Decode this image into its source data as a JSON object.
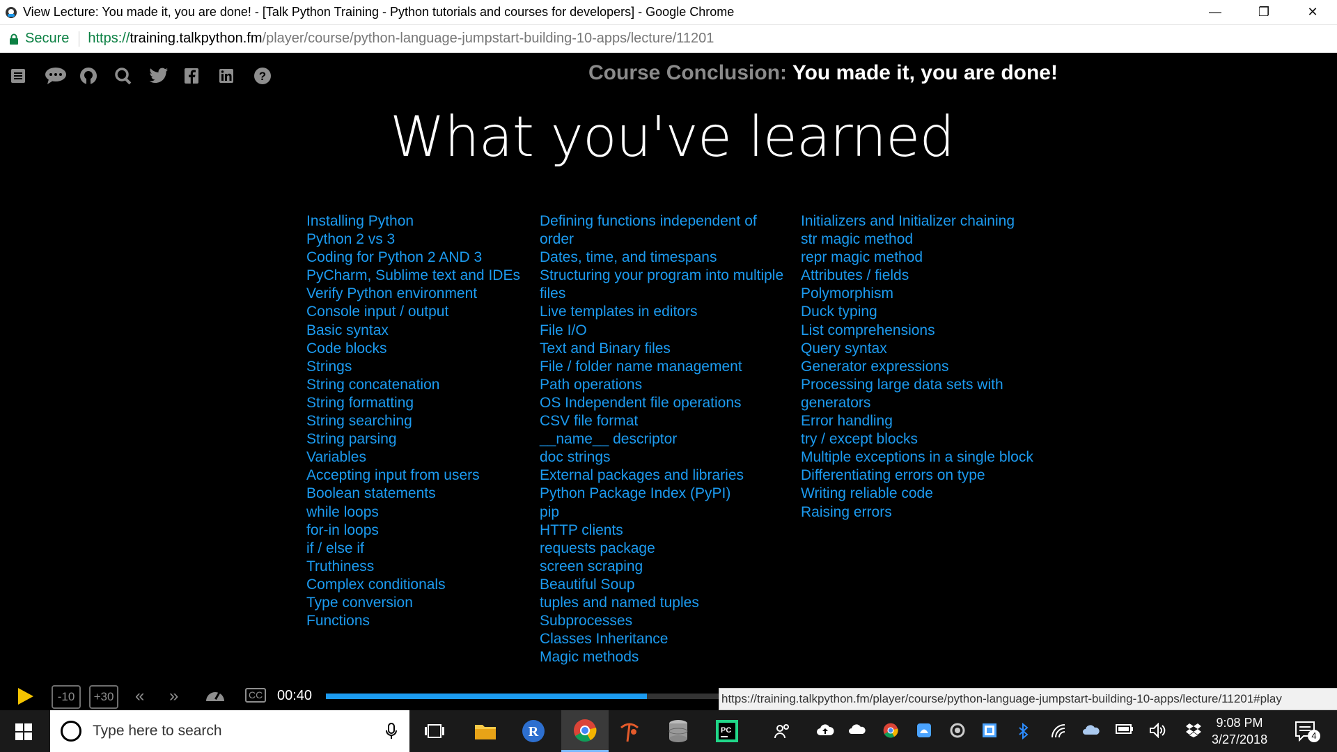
{
  "window": {
    "title": "View Lecture: You made it, you are done! - [Talk Python Training - Python tutorials and courses for developers] - Google Chrome",
    "minimize": "—",
    "restore": "❐",
    "close": "✕"
  },
  "address": {
    "secure_label": "Secure",
    "url_proto": "https://",
    "url_host": "training.talkpython.fm",
    "url_path": "/player/course/python-language-jumpstart-building-10-apps/lecture/11201"
  },
  "header": {
    "section_label": "Course Conclusion:",
    "lecture_title": "You made it, you are done!"
  },
  "slide": {
    "title": "What you've learned",
    "col1": [
      "Installing Python",
      "Python 2 vs 3",
      "Coding for Python 2 AND 3",
      "PyCharm, Sublime text and IDEs",
      "Verify Python environment",
      "Console input / output",
      "Basic syntax",
      "Code blocks",
      "Strings",
      "String concatenation",
      "String formatting",
      "String searching",
      "String parsing",
      "Variables",
      "Accepting input from users",
      "Boolean statements",
      "while loops",
      "for-in loops",
      "if / else if",
      "Truthiness",
      "Complex conditionals",
      "Type conversion",
      "Functions"
    ],
    "col2": [
      "Defining functions independent of",
      "order",
      "Dates, time, and timespans",
      "Structuring your program into multiple",
      "files",
      "Live templates in editors",
      "File I/O",
      "Text and Binary files",
      "File / folder name management",
      "Path operations",
      "OS Independent file operations",
      "CSV file format",
      "__name__ descriptor",
      "doc strings",
      "External packages and libraries",
      "Python Package Index (PyPI)",
      "pip",
      "HTTP clients",
      "requests package",
      "screen scraping",
      "Beautiful Soup",
      "tuples and named tuples",
      "Subprocesses",
      "Classes Inheritance",
      "Magic methods"
    ],
    "col3": [
      "Initializers and Initializer chaining",
      "str magic method",
      "repr magic method",
      "Attributes / fields",
      "Polymorphism",
      "Duck typing",
      "List comprehensions",
      "Query syntax",
      "Generator expressions",
      "Processing large data sets with",
      "generators",
      "Error handling",
      "try / except blocks",
      "Multiple exceptions in a single block",
      "Differentiating errors on type",
      "Writing reliable code",
      "Raising errors"
    ]
  },
  "player": {
    "skip_back": "-10",
    "skip_forward": "+30",
    "rewind": "«",
    "fast_forward": "»",
    "cc": "CC",
    "current_time": "00:40",
    "progress_fraction": 0.32,
    "status_url": "https://training.talkpython.fm/player/course/python-language-jumpstart-building-10-apps/lecture/11201#play"
  },
  "taskbar": {
    "search_placeholder": "Type here to search",
    "time": "9:08 PM",
    "date": "3/27/2018",
    "notification_count": "4"
  },
  "colors": {
    "accent": "#1c9bf0",
    "play": "#f5c400",
    "secure": "#0b8043"
  }
}
